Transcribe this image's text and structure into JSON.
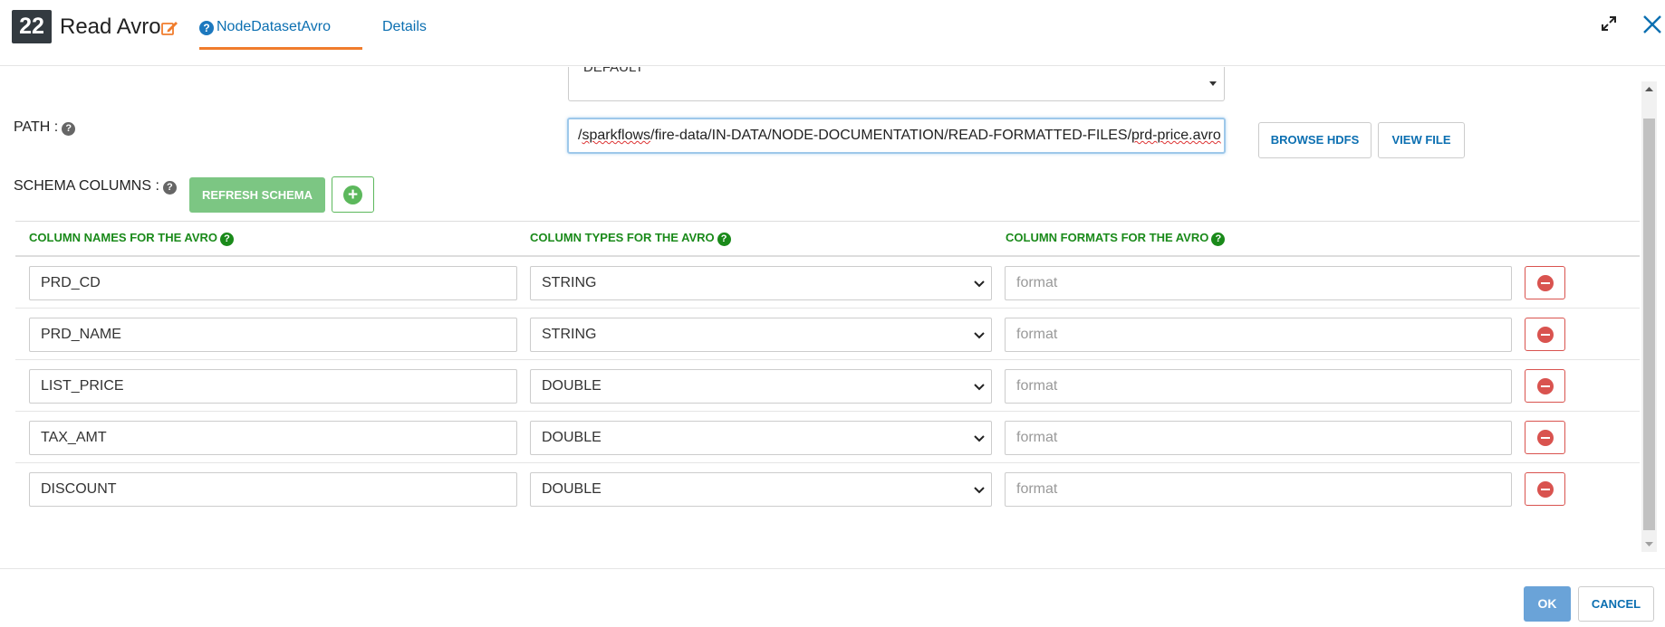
{
  "header": {
    "node_number": "22",
    "title": "Read Avro",
    "tabs": [
      {
        "label": "NodeDatasetAvro",
        "active": true
      },
      {
        "label": "Details",
        "active": false
      }
    ]
  },
  "form": {
    "top_select_value": "DEFAULT",
    "path_label": "PATH :",
    "path_value_parts": [
      "/",
      "sparkflows",
      "/fire-data/IN-DATA/NODE-DOCUMENTATION/READ-FORMATTED-FILES/",
      "prd-price.avro"
    ],
    "browse_label": "BROWSE HDFS",
    "view_file_label": "VIEW FILE",
    "schema_label": "SCHEMA COLUMNS :",
    "refresh_label": "REFRESH SCHEMA"
  },
  "table": {
    "headers": [
      "COLUMN NAMES FOR THE AVRO",
      "COLUMN TYPES FOR THE AVRO",
      "COLUMN FORMATS FOR THE AVRO"
    ],
    "format_placeholder": "format",
    "rows": [
      {
        "name": "PRD_CD",
        "type": "STRING"
      },
      {
        "name": "PRD_NAME",
        "type": "STRING"
      },
      {
        "name": "LIST_PRICE",
        "type": "DOUBLE"
      },
      {
        "name": "TAX_AMT",
        "type": "DOUBLE"
      },
      {
        "name": "DISCOUNT",
        "type": "DOUBLE"
      }
    ]
  },
  "footer": {
    "ok_label": "OK",
    "cancel_label": "CANCEL"
  },
  "colors": {
    "accent_tab": "#f07c2c",
    "link_blue": "#0b6fb1",
    "header_green": "#1a8a1a",
    "refresh_green": "#7cc683",
    "remove_red": "#d9534f",
    "ok_blue": "#6aa3d8"
  }
}
